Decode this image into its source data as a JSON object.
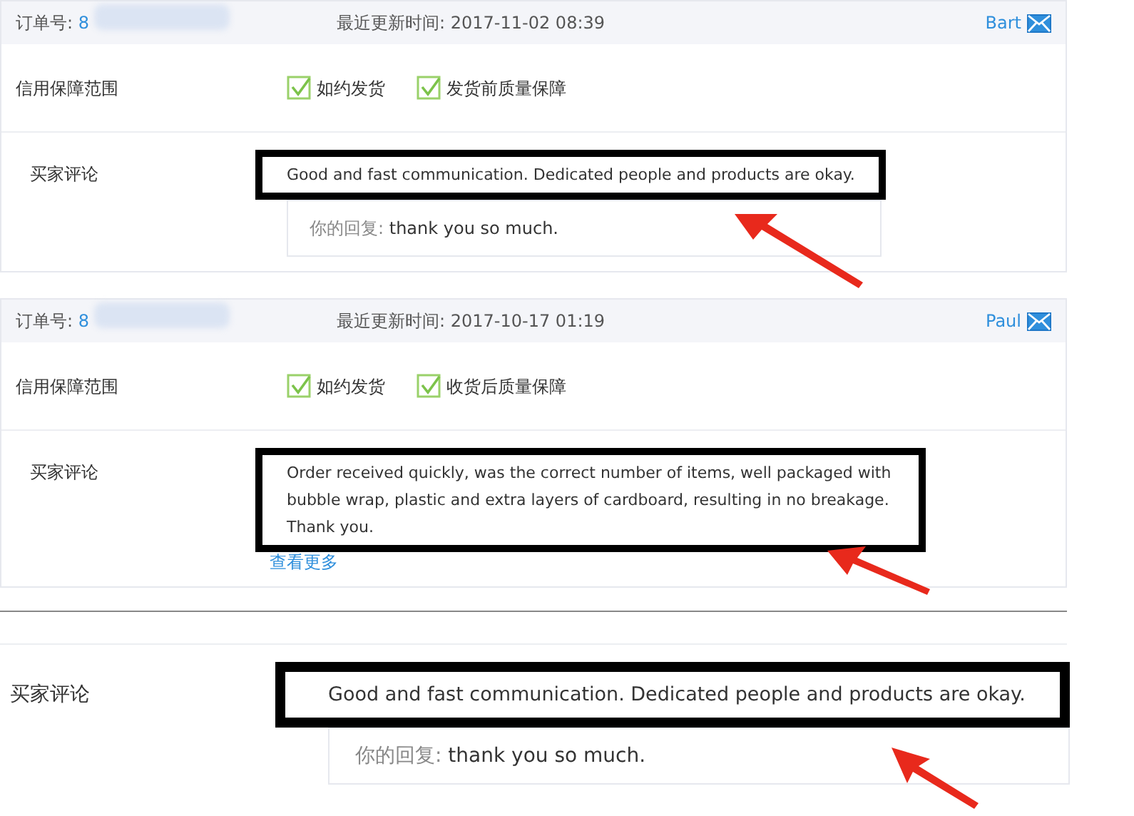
{
  "orders": [
    {
      "order_label": "订单号:",
      "order_number": "8",
      "updated_label": "最近更新时间:",
      "updated": "2017-11-02 08:39",
      "buyer": "Bart",
      "guarantee_label": "信用保障范围",
      "guarantees": [
        {
          "label": "如约发货",
          "checked": true
        },
        {
          "label": "发货前质量保障",
          "checked": true
        }
      ],
      "comment_label": "买家评论",
      "comment": "Good and fast communication. Dedicated people and products are okay.",
      "reply_label": "你的回复:",
      "reply": "thank you so much."
    },
    {
      "order_label": "订单号:",
      "order_number": "8",
      "updated_label": "最近更新时间:",
      "updated": "2017-10-17 01:19",
      "buyer": "Paul",
      "guarantee_label": "信用保障范围",
      "guarantees": [
        {
          "label": "如约发货",
          "checked": true
        },
        {
          "label": "收货后质量保障",
          "checked": true
        }
      ],
      "comment_label": "买家评论",
      "comment": "Order received quickly, was the correct number of items, well packaged with bubble wrap, plastic and extra layers of cardboard, resulting in no breakage. Thank you.",
      "more_link": "查看更多"
    }
  ],
  "zoomed_comment": {
    "comment_label": "买家评论",
    "comment": "Good and fast communication. Dedicated people and products are okay.",
    "reply_label": "你的回复:",
    "reply": "thank you so much."
  }
}
